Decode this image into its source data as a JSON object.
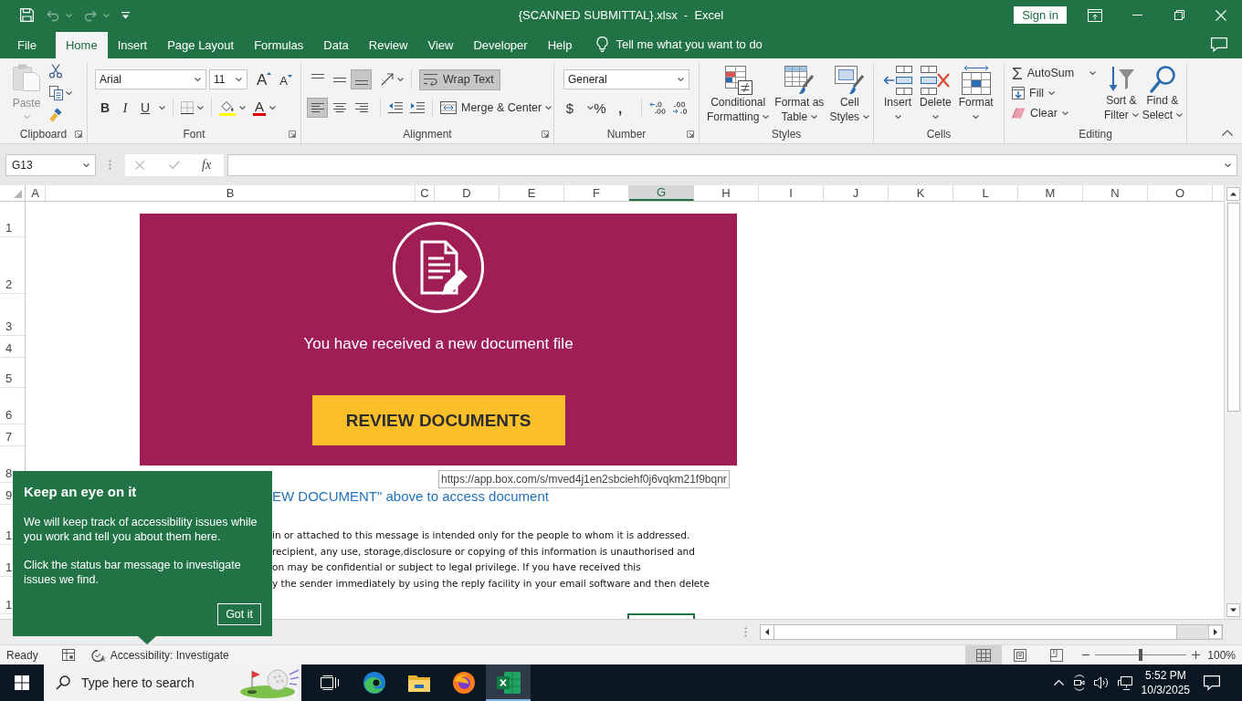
{
  "window": {
    "title": "{SCANNED SUBMITTAL}.xlsx  -  Excel",
    "sign_in": "Sign in"
  },
  "quick_access": [
    {
      "kind": "save",
      "disabled": false
    },
    {
      "kind": "undo",
      "disabled": true
    },
    {
      "kind": "redo",
      "disabled": true
    },
    {
      "kind": "customize",
      "disabled": false
    }
  ],
  "ribbon_tabs": [
    {
      "label": "File",
      "selected": false
    },
    {
      "label": "Home",
      "selected": true
    },
    {
      "label": "Insert",
      "selected": false
    },
    {
      "label": "Page Layout",
      "selected": false
    },
    {
      "label": "Formulas",
      "selected": false
    },
    {
      "label": "Data",
      "selected": false
    },
    {
      "label": "Review",
      "selected": false
    },
    {
      "label": "View",
      "selected": false
    },
    {
      "label": "Developer",
      "selected": false
    },
    {
      "label": "Help",
      "selected": false
    }
  ],
  "tell_me": {
    "placeholder": "Tell me what you want to do"
  },
  "clipboard": {
    "label": "Clipboard",
    "paste": {
      "label": "Paste",
      "disabled": true
    }
  },
  "font": {
    "label": "Font",
    "name": "Arial",
    "size": "11",
    "size_buttons": [
      {
        "kind": "grow",
        "glyph": "A"
      },
      {
        "kind": "shrink",
        "glyph": "A"
      }
    ],
    "styles": [
      {
        "kind": "bold",
        "glyph": "B"
      },
      {
        "kind": "italic",
        "glyph": "I"
      },
      {
        "kind": "underline",
        "glyph": "U"
      }
    ],
    "font_color": {
      "glyph": "A"
    }
  },
  "alignment": {
    "label": "Alignment",
    "vertical": [
      {
        "kind": "top",
        "selected": false
      },
      {
        "kind": "middle",
        "selected": false
      },
      {
        "kind": "bottom",
        "selected": true
      }
    ],
    "horizontal": [
      {
        "kind": "left",
        "selected": true
      },
      {
        "kind": "center",
        "selected": false
      },
      {
        "kind": "right",
        "selected": false
      }
    ],
    "wrap_text": {
      "label": "Wrap Text",
      "selected": true
    },
    "merge": {
      "label": "Merge & Center"
    }
  },
  "number": {
    "label": "Number",
    "format": "General",
    "buttons": [
      {
        "kind": "currency",
        "glyph": "$"
      },
      {
        "kind": "percent",
        "glyph": "%"
      },
      {
        "kind": "comma",
        "glyph": ","
      }
    ]
  },
  "styles": {
    "label": "Styles",
    "buttons": [
      {
        "kind": "conditional",
        "label_lines": [
          "Conditional",
          "Formatting"
        ]
      },
      {
        "kind": "table",
        "label_lines": [
          "Format as",
          "Table"
        ]
      },
      {
        "kind": "cell_styles",
        "label_lines": [
          "Cell",
          "Styles"
        ]
      }
    ]
  },
  "cells": {
    "label": "Cells",
    "buttons": [
      {
        "kind": "insert",
        "label": "Insert"
      },
      {
        "kind": "delete",
        "label": "Delete"
      },
      {
        "kind": "format",
        "label": "Format"
      }
    ]
  },
  "editing": {
    "label": "Editing",
    "small": [
      {
        "kind": "autosum",
        "glyph": "Σ",
        "label": "AutoSum"
      },
      {
        "kind": "fill",
        "label": "Fill"
      },
      {
        "kind": "clear",
        "label": "Clear"
      }
    ],
    "large": [
      {
        "kind": "sort",
        "label_lines": [
          "Sort &",
          "Filter"
        ]
      },
      {
        "kind": "find",
        "label_lines": [
          "Find &",
          "Select"
        ]
      }
    ]
  },
  "formula_bar": {
    "name_box": "G13",
    "function_button": "fx",
    "edit_buttons_disabled": true
  },
  "columns": [
    {
      "label": "A",
      "selected": false
    },
    {
      "label": "B",
      "selected": false
    },
    {
      "label": "C",
      "selected": false
    },
    {
      "label": "D",
      "selected": false
    },
    {
      "label": "E",
      "selected": false
    },
    {
      "label": "F",
      "selected": false
    },
    {
      "label": "G",
      "selected": true
    },
    {
      "label": "H",
      "selected": false
    },
    {
      "label": "I",
      "selected": false
    },
    {
      "label": "J",
      "selected": false
    },
    {
      "label": "K",
      "selected": false
    },
    {
      "label": "L",
      "selected": false
    },
    {
      "label": "M",
      "selected": false
    },
    {
      "label": "N",
      "selected": false
    },
    {
      "label": "O",
      "selected": false
    }
  ],
  "rows": [
    {
      "label": "1"
    },
    {
      "label": "2"
    },
    {
      "label": "3"
    },
    {
      "label": "4"
    },
    {
      "label": "5"
    },
    {
      "label": "6"
    },
    {
      "label": "7"
    },
    {
      "label": "8"
    },
    {
      "label": "9"
    },
    {
      "label": "1"
    },
    {
      "label": "1"
    },
    {
      "label": "1"
    }
  ],
  "sheet": {
    "banner": {
      "message": "You have received a new document file",
      "button": "REVIEW DOCUMENTS"
    },
    "link_tooltip": "https://app.box.com/s/mved4j1en2sbciehf0j6vqkm21f9bqnr",
    "instruction": "EW DOCUMENT\" above to access document",
    "disclaimer_lines": [
      "in or attached to this message is intended only for the people to whom it is addressed.",
      "recipient, any use, storage,disclosure or copying of this information is unauthorised and",
      "on may be confidential or subject to legal privilege. If you have received this",
      "y the sender immediately by using the reply facility in your email software and then delete"
    ]
  },
  "accessibility_tip": {
    "title": "Keep an eye on it",
    "paragraphs": [
      "We will keep track of accessibility issues while you work and tell you about them here.",
      "Click the status bar message to investigate issues we find."
    ],
    "button": "Got it"
  },
  "status_bar": {
    "mode": "Ready",
    "accessibility": "Accessibility: Investigate",
    "views": [
      {
        "kind": "normal",
        "selected": true
      },
      {
        "kind": "page_layout",
        "selected": false
      },
      {
        "kind": "page_break",
        "selected": false
      }
    ],
    "zoom": {
      "level": 0.5,
      "reading": "100%"
    }
  },
  "taskbar": {
    "search": {
      "placeholder": "Type here to search"
    },
    "apps": [
      {
        "kind": "task_view",
        "active": false
      },
      {
        "kind": "edge",
        "active": false
      },
      {
        "kind": "explorer",
        "active": false
      },
      {
        "kind": "firefox",
        "active": false
      },
      {
        "kind": "excel",
        "active": true
      }
    ],
    "time": "5:52 PM",
    "date": "10/3/2025"
  }
}
